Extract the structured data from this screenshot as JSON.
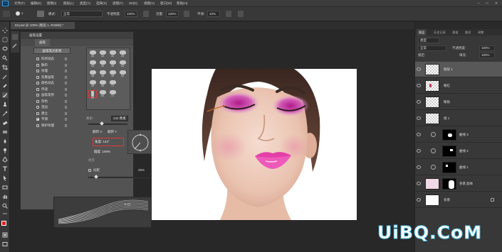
{
  "menubar": {
    "logo": "Ps",
    "items": [
      "文件(F)",
      "编辑(E)",
      "图像(I)",
      "图层(L)",
      "类型(Y)",
      "选择(S)",
      "滤镜(T)",
      "3D(D)",
      "视图(V)",
      "窗口(W)",
      "帮助(H)"
    ],
    "minimize": "─",
    "maximize": "□",
    "close": "✕"
  },
  "options": {
    "brush_size": "1",
    "mode_label": "模式:",
    "mode_value": "正常",
    "opacity_label": "不透明度:",
    "opacity_value": "100%",
    "flow_label": "流量:",
    "flow_value": "100%",
    "smoothing_label": "平滑:",
    "smoothing_value": "10%"
  },
  "document": {
    "tab_label": "63.psd @ 100% (图层 1, RGB/8) *"
  },
  "brush_panel": {
    "title": "画笔设置",
    "tab": "画笔",
    "preset_button": "画笔笔尖形状",
    "options": [
      {
        "label": "形状动态",
        "checked": false
      },
      {
        "label": "散布",
        "checked": false
      },
      {
        "label": "纹理",
        "checked": false
      },
      {
        "label": "双重画笔",
        "checked": false
      },
      {
        "label": "颜色动态",
        "checked": false
      },
      {
        "label": "传递",
        "checked": false
      },
      {
        "label": "画笔笔势",
        "checked": false
      },
      {
        "label": "杂色",
        "checked": false
      },
      {
        "label": "湿边",
        "checked": false
      },
      {
        "label": "建立",
        "checked": false
      },
      {
        "label": "平滑",
        "checked": true
      },
      {
        "label": "保护纹理",
        "checked": false
      }
    ],
    "tips": [
      "30",
      "30",
      "30",
      "25",
      "25",
      "25",
      "36",
      "25",
      "36",
      "36",
      "36",
      "32",
      "25",
      "50",
      "71",
      "25",
      "50",
      "71"
    ],
    "size_label": "大小",
    "size_value": "122 像素",
    "flip_x": "翻转 X",
    "flip_y": "翻转 Y",
    "angle_label": "角度:",
    "angle_value": "124°",
    "roundness_label": "圆度:",
    "roundness_value": "100%",
    "hardness_label": "硬度",
    "spacing_label": "间距",
    "spacing_value": "25%",
    "footer_icons": "⌗ ⊡"
  },
  "layers_panel": {
    "tabs": [
      "图层",
      "历史记录",
      "通道",
      "路径",
      "调整"
    ],
    "kind_label": "类型",
    "blend_mode": "正常",
    "opacity_label": "不透明度:",
    "opacity_value": "100%",
    "lock_label": "锁定:",
    "fill_label": "填充:",
    "fill_value": "100%",
    "layers": [
      {
        "name": "图层 1"
      },
      {
        "name": "眼红"
      },
      {
        "name": "眼角"
      },
      {
        "name": "组 1"
      },
      {
        "name": "曲线 3"
      },
      {
        "name": "曲线 2"
      },
      {
        "name": "曲线 1"
      },
      {
        "name": "背景 副本"
      },
      {
        "name": "背景"
      }
    ]
  },
  "watermark": "UiBQ.CoM"
}
